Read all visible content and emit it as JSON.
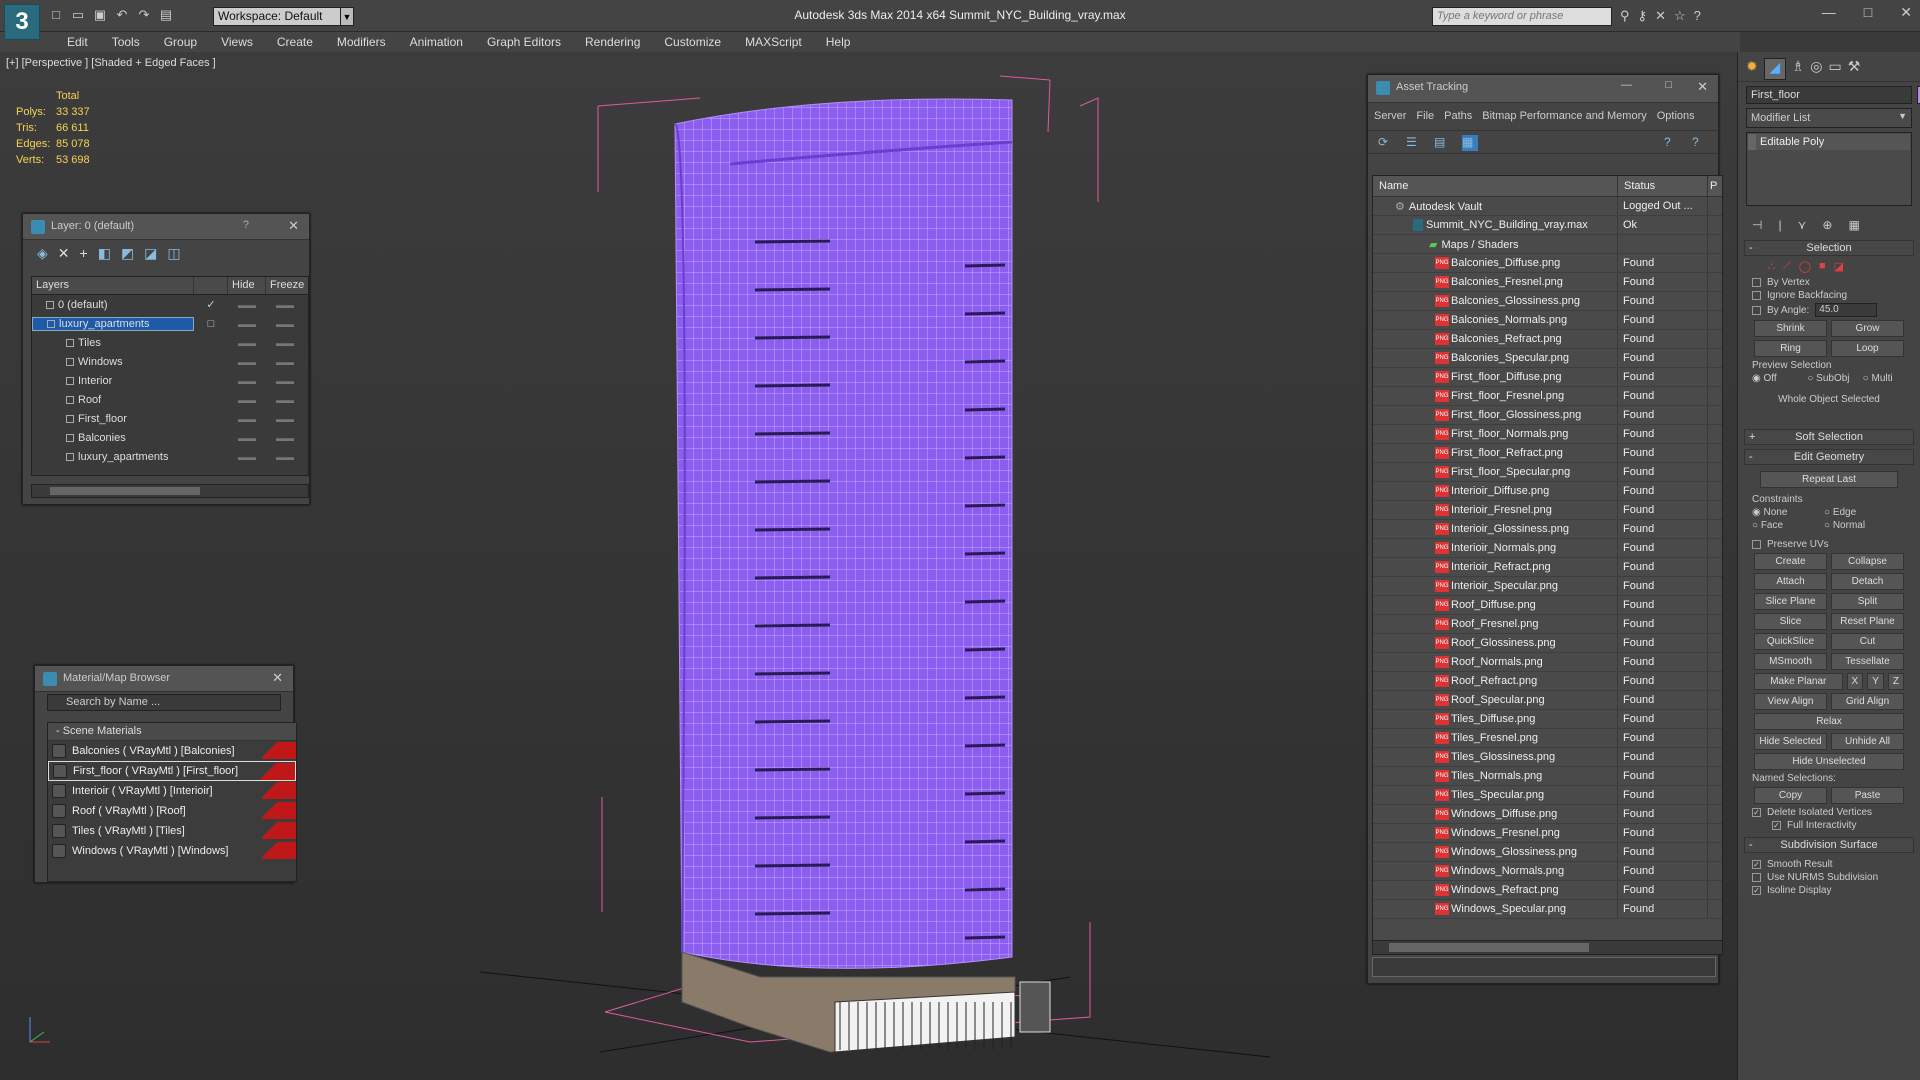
{
  "app": {
    "title": "Autodesk 3ds Max  2014 x64     Summit_NYC_Building_vray.max",
    "workspace": "Workspace: Default",
    "search_placeholder": "Type a keyword or phrase"
  },
  "menu": [
    "Edit",
    "Tools",
    "Group",
    "Views",
    "Create",
    "Modifiers",
    "Animation",
    "Graph Editors",
    "Rendering",
    "Customize",
    "MAXScript",
    "Help"
  ],
  "viewport": {
    "label": "[+] [Perspective ] [Shaded + Edged Faces ]",
    "stats_header": "Total",
    "stats": [
      {
        "label": "Polys:",
        "value": "33 337"
      },
      {
        "label": "Tris:",
        "value": "66 611"
      },
      {
        "label": "Edges:",
        "value": "85 078"
      },
      {
        "label": "Verts:",
        "value": "53 698"
      }
    ]
  },
  "layer_panel": {
    "title": "Layer: 0 (default)",
    "help": "?",
    "columns": [
      "Layers",
      "Hide",
      "Freeze"
    ],
    "rows": [
      {
        "name": "0 (default)",
        "indent": 1,
        "mark": "✓",
        "selected": false
      },
      {
        "name": "luxury_apartments",
        "indent": 1,
        "mark": "□",
        "selected": true
      },
      {
        "name": "Tiles",
        "indent": 2,
        "mark": "",
        "selected": false
      },
      {
        "name": "Windows",
        "indent": 2,
        "mark": "",
        "selected": false
      },
      {
        "name": "Interior",
        "indent": 2,
        "mark": "",
        "selected": false
      },
      {
        "name": "Roof",
        "indent": 2,
        "mark": "",
        "selected": false
      },
      {
        "name": "First_floor",
        "indent": 2,
        "mark": "",
        "selected": false
      },
      {
        "name": "Balconies",
        "indent": 2,
        "mark": "",
        "selected": false
      },
      {
        "name": "luxury_apartments",
        "indent": 2,
        "mark": "",
        "selected": false
      }
    ]
  },
  "material_browser": {
    "title": "Material/Map Browser",
    "search_placeholder": "Search by Name ...",
    "group": "- Scene Materials",
    "items": [
      {
        "label": "Balconies  ( VRayMtl ) [Balconies]",
        "selected": false
      },
      {
        "label": "First_floor  ( VRayMtl ) [First_floor]",
        "selected": true
      },
      {
        "label": "Interioir  ( VRayMtl ) [Interioir]",
        "selected": false
      },
      {
        "label": "Roof  ( VRayMtl ) [Roof]",
        "selected": false
      },
      {
        "label": "Tiles  ( VRayMtl ) [Tiles]",
        "selected": false
      },
      {
        "label": "Windows  ( VRayMtl ) [Windows]",
        "selected": false
      }
    ]
  },
  "asset_tracking": {
    "title": "Asset Tracking",
    "menu": [
      "Server",
      "File",
      "Paths",
      "Bitmap Performance and Memory",
      "Options"
    ],
    "columns": [
      "Name",
      "Status",
      "P"
    ],
    "rows": [
      {
        "name": "Autodesk Vault",
        "status": "Logged Out ...",
        "indent": 1,
        "icon": "vault"
      },
      {
        "name": "Summit_NYC_Building_vray.max",
        "status": "Ok",
        "indent": 2,
        "icon": "max"
      },
      {
        "name": "Maps / Shaders",
        "status": "",
        "indent": 3,
        "icon": "folder"
      },
      {
        "name": "Balconies_Diffuse.png",
        "status": "Found",
        "indent": 4,
        "icon": "png"
      },
      {
        "name": "Balconies_Fresnel.png",
        "status": "Found",
        "indent": 4,
        "icon": "png"
      },
      {
        "name": "Balconies_Glossiness.png",
        "status": "Found",
        "indent": 4,
        "icon": "png"
      },
      {
        "name": "Balconies_Normals.png",
        "status": "Found",
        "indent": 4,
        "icon": "png"
      },
      {
        "name": "Balconies_Refract.png",
        "status": "Found",
        "indent": 4,
        "icon": "png"
      },
      {
        "name": "Balconies_Specular.png",
        "status": "Found",
        "indent": 4,
        "icon": "png"
      },
      {
        "name": "First_floor_Diffuse.png",
        "status": "Found",
        "indent": 4,
        "icon": "png"
      },
      {
        "name": "First_floor_Fresnel.png",
        "status": "Found",
        "indent": 4,
        "icon": "png"
      },
      {
        "name": "First_floor_Glossiness.png",
        "status": "Found",
        "indent": 4,
        "icon": "png"
      },
      {
        "name": "First_floor_Normals.png",
        "status": "Found",
        "indent": 4,
        "icon": "png"
      },
      {
        "name": "First_floor_Refract.png",
        "status": "Found",
        "indent": 4,
        "icon": "png"
      },
      {
        "name": "First_floor_Specular.png",
        "status": "Found",
        "indent": 4,
        "icon": "png"
      },
      {
        "name": "Interioir_Diffuse.png",
        "status": "Found",
        "indent": 4,
        "icon": "png"
      },
      {
        "name": "Interioir_Fresnel.png",
        "status": "Found",
        "indent": 4,
        "icon": "png"
      },
      {
        "name": "Interioir_Glossiness.png",
        "status": "Found",
        "indent": 4,
        "icon": "png"
      },
      {
        "name": "Interioir_Normals.png",
        "status": "Found",
        "indent": 4,
        "icon": "png"
      },
      {
        "name": "Interioir_Refract.png",
        "status": "Found",
        "indent": 4,
        "icon": "png"
      },
      {
        "name": "Interioir_Specular.png",
        "status": "Found",
        "indent": 4,
        "icon": "png"
      },
      {
        "name": "Roof_Diffuse.png",
        "status": "Found",
        "indent": 4,
        "icon": "png"
      },
      {
        "name": "Roof_Fresnel.png",
        "status": "Found",
        "indent": 4,
        "icon": "png"
      },
      {
        "name": "Roof_Glossiness.png",
        "status": "Found",
        "indent": 4,
        "icon": "png"
      },
      {
        "name": "Roof_Normals.png",
        "status": "Found",
        "indent": 4,
        "icon": "png"
      },
      {
        "name": "Roof_Refract.png",
        "status": "Found",
        "indent": 4,
        "icon": "png"
      },
      {
        "name": "Roof_Specular.png",
        "status": "Found",
        "indent": 4,
        "icon": "png"
      },
      {
        "name": "Tiles_Diffuse.png",
        "status": "Found",
        "indent": 4,
        "icon": "png"
      },
      {
        "name": "Tiles_Fresnel.png",
        "status": "Found",
        "indent": 4,
        "icon": "png"
      },
      {
        "name": "Tiles_Glossiness.png",
        "status": "Found",
        "indent": 4,
        "icon": "png"
      },
      {
        "name": "Tiles_Normals.png",
        "status": "Found",
        "indent": 4,
        "icon": "png"
      },
      {
        "name": "Tiles_Specular.png",
        "status": "Found",
        "indent": 4,
        "icon": "png"
      },
      {
        "name": "Windows_Diffuse.png",
        "status": "Found",
        "indent": 4,
        "icon": "png"
      },
      {
        "name": "Windows_Fresnel.png",
        "status": "Found",
        "indent": 4,
        "icon": "png"
      },
      {
        "name": "Windows_Glossiness.png",
        "status": "Found",
        "indent": 4,
        "icon": "png"
      },
      {
        "name": "Windows_Normals.png",
        "status": "Found",
        "indent": 4,
        "icon": "png"
      },
      {
        "name": "Windows_Refract.png",
        "status": "Found",
        "indent": 4,
        "icon": "png"
      },
      {
        "name": "Windows_Specular.png",
        "status": "Found",
        "indent": 4,
        "icon": "png"
      }
    ]
  },
  "command_panel": {
    "object_name": "First_floor",
    "object_color": "#b48ce6",
    "modifier_list": "Modifier List",
    "stack": [
      "Editable Poly"
    ],
    "selection": {
      "title": "Selection",
      "by_vertex": "By Vertex",
      "ignore_backfacing": "Ignore Backfacing",
      "by_angle": "By Angle:",
      "angle_value": "45.0",
      "shrink": "Shrink",
      "grow": "Grow",
      "ring": "Ring",
      "loop": "Loop",
      "preview": "Preview Selection",
      "preview_opts": [
        "Off",
        "SubObj",
        "Multi"
      ],
      "status": "Whole Object Selected"
    },
    "soft_selection": "Soft Selection",
    "edit_geometry": {
      "title": "Edit Geometry",
      "repeat_last": "Repeat Last",
      "constraints": "Constraints",
      "constraint_opts": [
        "None",
        "Edge",
        "Face",
        "Normal"
      ],
      "preserve_uvs": "Preserve UVs",
      "buttons": [
        [
          "Create",
          "Collapse"
        ],
        [
          "Attach",
          "Detach"
        ],
        [
          "Slice Plane",
          "Split"
        ],
        [
          "Slice",
          "Reset Plane"
        ],
        [
          "QuickSlice",
          "Cut"
        ],
        [
          "MSmooth",
          "Tessellate"
        ],
        [
          "Make Planar",
          "X",
          "Y",
          "Z"
        ],
        [
          "View Align",
          "Grid Align"
        ],
        [
          "Relax"
        ],
        [
          "Hide Selected",
          "Unhide All"
        ],
        [
          "Hide Unselected"
        ]
      ],
      "named_selections": "Named Selections:",
      "copy": "Copy",
      "paste": "Paste",
      "delete_isolated": "Delete Isolated Vertices",
      "full_interactivity": "Full Interactivity"
    },
    "subdivision": {
      "title": "Subdivision Surface",
      "smooth_result": "Smooth Result",
      "use_nurms": "Use NURMS Subdivision",
      "isoline": "Isoline Display"
    }
  },
  "colors": {
    "wire": "#9a64ff",
    "bbox": "#e05aa0",
    "accent": "#1f5aa8"
  }
}
